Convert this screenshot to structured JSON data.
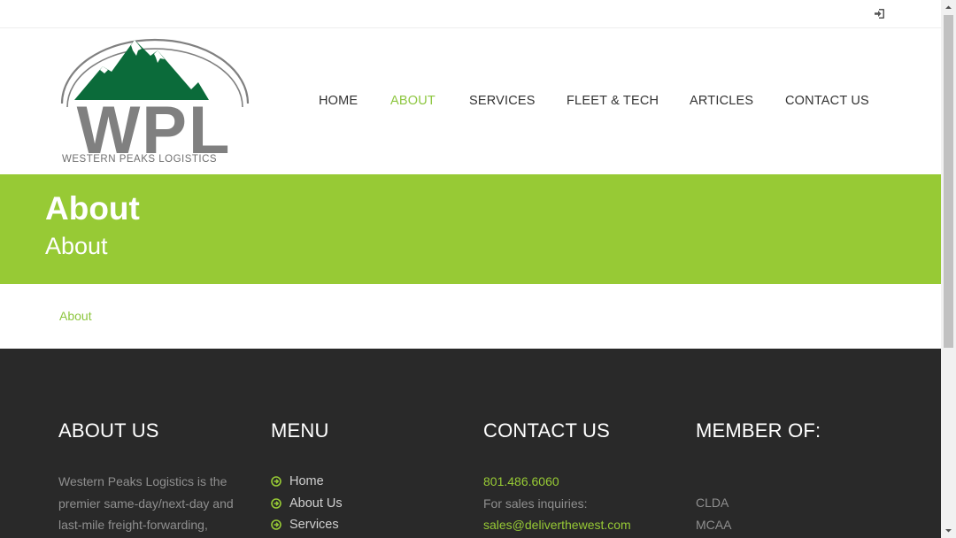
{
  "topbar": {
    "login_icon": "sign-in-icon"
  },
  "logo": {
    "letters": "WPL",
    "tagline": "WESTERN PEAKS LOGISTICS"
  },
  "nav": {
    "items": [
      {
        "label": "HOME",
        "active": false
      },
      {
        "label": "ABOUT",
        "active": true
      },
      {
        "label": "SERVICES",
        "active": false
      },
      {
        "label": "FLEET & TECH",
        "active": false
      },
      {
        "label": "ARTICLES",
        "active": false
      },
      {
        "label": "CONTACT US",
        "active": false
      }
    ]
  },
  "banner": {
    "title": "About",
    "subtitle": "About",
    "color": "#97ca35"
  },
  "breadcrumb": {
    "current": "About"
  },
  "footer": {
    "about": {
      "heading": "ABOUT US",
      "text": "Western Peaks Logistics is the premier same-day/next-day and last-mile freight-forwarding,"
    },
    "menu": {
      "heading": "MENU",
      "items": [
        "Home",
        "About Us",
        "Services"
      ]
    },
    "contact": {
      "heading": "CONTACT US",
      "phone": "801.486.6060",
      "sales_label": "For sales inquiries:",
      "email": "sales@deliverthewest.com"
    },
    "member": {
      "heading": "MEMBER OF:",
      "items": [
        "CLDA",
        "MCAA"
      ]
    }
  },
  "colors": {
    "accent": "#97ca35",
    "footer_bg": "#292929",
    "logo_green": "#0b6b3a",
    "logo_grey": "#808080"
  }
}
